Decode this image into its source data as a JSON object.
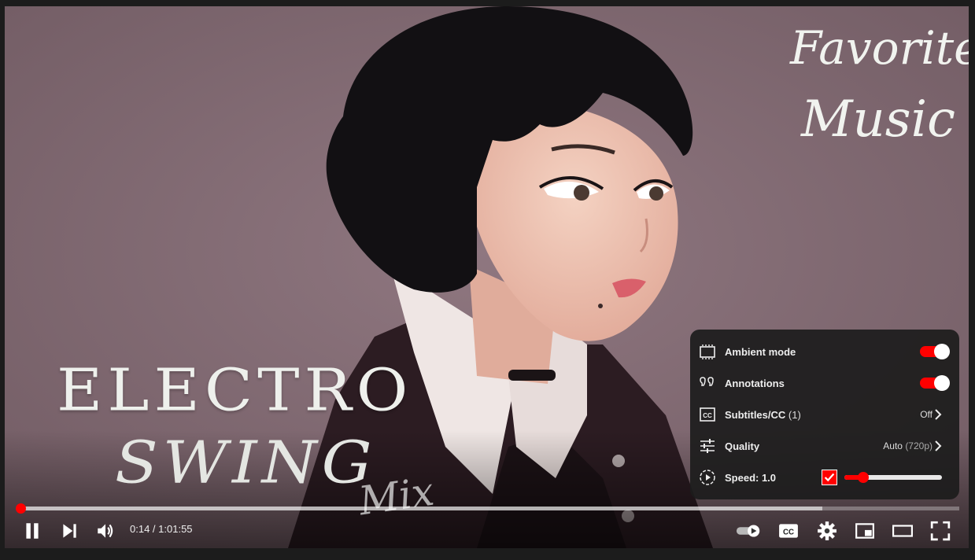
{
  "video": {
    "title_line1": "ELECTRO",
    "title_line2": "SWING",
    "title_line3": "Mix",
    "corner_line1": "Favorite",
    "corner_line2": "Music"
  },
  "progress": {
    "played_fraction": 0.003,
    "buffered_fraction": 0.855
  },
  "controls": {
    "time_current": "0:14",
    "time_separator": " / ",
    "time_total": "1:01:55",
    "left_icons": [
      "pause-icon",
      "next-icon",
      "volume-icon"
    ],
    "right_icons": [
      "autoplay-toggle-icon",
      "subtitles-icon",
      "settings-gear-icon",
      "miniplayer-icon",
      "theater-mode-icon",
      "fullscreen-icon"
    ]
  },
  "settings": {
    "items": [
      {
        "label": "Ambient mode",
        "icon": "ambient-mode-icon",
        "toggle": true
      },
      {
        "label": "Annotations",
        "icon": "annotations-icon",
        "toggle": true
      },
      {
        "label": "Subtitles/CC",
        "count": "(1)",
        "icon": "cc-icon",
        "value": "Off"
      },
      {
        "label": "Quality",
        "icon": "quality-sliders-icon",
        "value": "Auto",
        "value_sub": "(720p)"
      },
      {
        "label": "Speed: 1.0",
        "icon": "speed-icon",
        "speed_checked": true,
        "speed_fraction": 0.19
      }
    ]
  },
  "colors": {
    "accent": "#ff0000",
    "menu_bg": "#1c1c1c",
    "video_bg": "#846c74"
  }
}
